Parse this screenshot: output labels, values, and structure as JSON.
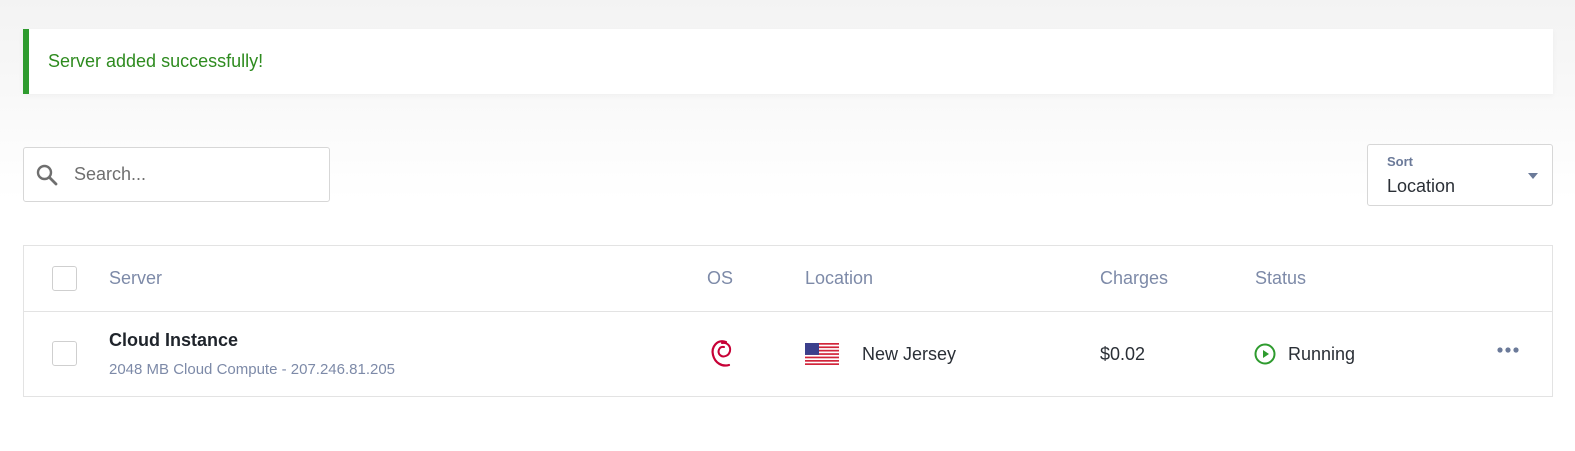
{
  "alert": {
    "message": "Server added successfully!"
  },
  "search": {
    "placeholder": "Search..."
  },
  "sort": {
    "label": "Sort",
    "value": "Location"
  },
  "table": {
    "headers": {
      "server": "Server",
      "os": "OS",
      "location": "Location",
      "charges": "Charges",
      "status": "Status"
    },
    "rows": [
      {
        "name": "Cloud Instance",
        "details": "2048 MB Cloud Compute - 207.246.81.205",
        "os_icon": "debian-icon",
        "flag_icon": "us-flag-icon",
        "location": "New Jersey",
        "charges": "$0.02",
        "status": "Running",
        "status_icon": "play-circle-icon"
      }
    ]
  },
  "colors": {
    "success": "#2e9b2e",
    "header_text": "#7d8aa8",
    "debian": "#c70036"
  }
}
